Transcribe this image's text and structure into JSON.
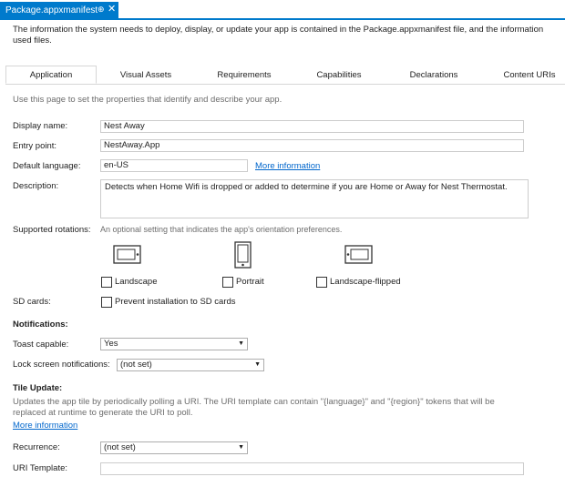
{
  "doc_tab": {
    "title": "Package.appxmanifest",
    "pin": "⊕",
    "close": "✕"
  },
  "intro": "The information the system needs to deploy, display, or update your app is contained in the Package.appxmanifest file, and the information used files.",
  "tabs": [
    "Application",
    "Visual Assets",
    "Requirements",
    "Capabilities",
    "Declarations",
    "Content URIs"
  ],
  "hint": "Use this page to set the properties that identify and describe your app.",
  "fields": {
    "display_name_label": "Display name:",
    "display_name_value": "Nest Away",
    "entry_point_label": "Entry point:",
    "entry_point_value": "NestAway.App",
    "default_language_label": "Default language:",
    "default_language_value": "en-US",
    "more_info": "More information",
    "description_label": "Description:",
    "description_value": "Detects when Home Wifi is dropped or added to determine if you are Home or Away for Nest Thermostat."
  },
  "rotations": {
    "label": "Supported rotations:",
    "hint": "An optional setting that indicates the app's orientation preferences.",
    "landscape": "Landscape",
    "portrait": "Portrait",
    "landscape_flipped": "Landscape-flipped"
  },
  "sd": {
    "label": "SD cards:",
    "option": "Prevent installation to SD cards"
  },
  "notifications": {
    "heading": "Notifications:",
    "toast_label": "Toast capable:",
    "toast_value": "Yes",
    "lock_label": "Lock screen notifications:",
    "lock_value": "(not set)"
  },
  "tile": {
    "heading": "Tile Update:",
    "desc": "Updates the app tile by periodically polling a URI. The URI template can contain \"{language}\" and \"{region}\" tokens that will be replaced at runtime to generate the URI to poll.",
    "more_info": "More information",
    "recurrence_label": "Recurrence:",
    "recurrence_value": "(not set)",
    "uri_label": "URI Template:",
    "uri_value": ""
  },
  "colors": {
    "accent": "#007acc",
    "link": "#0066cc",
    "hint": "#6d6d6d"
  }
}
